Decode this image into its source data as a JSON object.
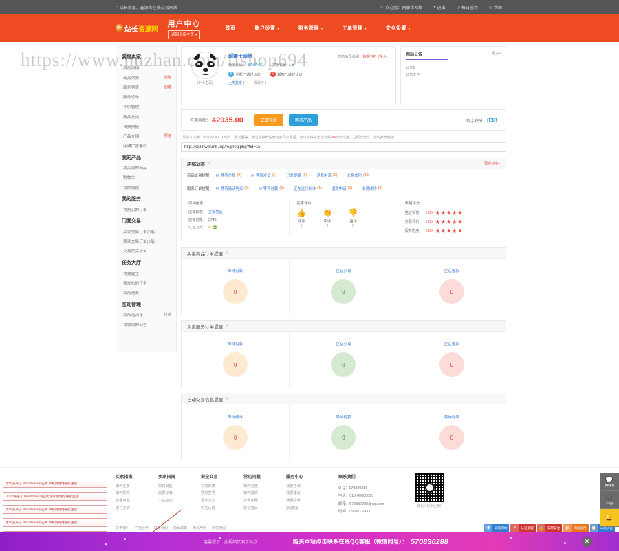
{
  "topbar": {
    "home_icon": "home-icon",
    "slogan": "站长资源，鑫源的在线交易网站",
    "welcome_icon": "user-icon",
    "welcome": "欢迎您：网嫌士网络",
    "logout_caret": "chevron-down-icon",
    "logout": "退出",
    "signin_icon": "clock-icon",
    "signin": "每日签到",
    "help_icon": "question-icon",
    "help": "帮助"
  },
  "nav": {
    "logo_a": "站长",
    "logo_b": "资源网",
    "center_title": "用户中心",
    "back_home": "返回合店主页",
    "items": [
      {
        "label": "首页",
        "caret": false
      },
      {
        "label": "账户设置",
        "caret": true
      },
      {
        "label": "财务管理",
        "caret": true
      },
      {
        "label": "工单管理",
        "caret": true
      },
      {
        "label": "安全设置",
        "caret": true
      }
    ]
  },
  "sidebar": {
    "groups": [
      {
        "title": "我是卖家",
        "items": [
          {
            "label": "我的店铺",
            "tag": ""
          },
          {
            "label": "商品列表",
            "tag": "创建"
          },
          {
            "label": "服务列表",
            "tag": "创建"
          },
          {
            "label": "服务订单",
            "tag": ""
          },
          {
            "label": "评价管理",
            "tag": ""
          },
          {
            "label": "商品分类",
            "tag": ""
          },
          {
            "label": "自费模板",
            "tag": ""
          },
          {
            "label": "产品介绍",
            "tag": "预览"
          },
          {
            "label": "店铺广告素材",
            "tag": ""
          }
        ]
      },
      {
        "title": "我的产品",
        "items": [
          {
            "label": "我买到的商品",
            "tag": ""
          },
          {
            "label": "购物车",
            "tag": ""
          },
          {
            "label": "我的收藏",
            "tag": ""
          }
        ]
      },
      {
        "title": "我的服务",
        "items": [
          {
            "label": "我购买的订单",
            "tag": ""
          }
        ]
      },
      {
        "title": "门面交易",
        "items": [
          {
            "label": "买家交易订单(0笔)",
            "tag": ""
          },
          {
            "label": "卖家交易订单(0笔)",
            "tag": ""
          },
          {
            "label": "交易已完成单",
            "tag": ""
          }
        ]
      },
      {
        "title": "任务大厅",
        "items": [
          {
            "label": "我要雇主",
            "tag": ""
          },
          {
            "label": "我发布的任务",
            "tag": ""
          },
          {
            "label": "我的任务",
            "tag": ""
          }
        ]
      },
      {
        "title": "互动管理",
        "items": [
          {
            "label": "我的站内信",
            "tag": "投稿"
          },
          {
            "label": "我收到的公告",
            "tag": ""
          }
        ]
      }
    ]
  },
  "profile": {
    "avatar_name": "panda-avatar",
    "avatar_label": "(个人主页)",
    "username": "网嫌士网络",
    "vip_label": "您的会员级别：",
    "vip_value": "铂金VIP（永久）",
    "seller_label": "卖家评价：",
    "seller_icons": "💎💎💎",
    "buyer_label": "买家评价：",
    "buyer_icon": "★",
    "verify_phone": "手机已通过认证",
    "verify_mail": "邮箱已通过认证",
    "link_realname": "上传鉴定丨",
    "link_ip": "修改IP丨"
  },
  "notice": {
    "title": "网站公告",
    "more": "更多+",
    "items": [
      "公告2",
      "公告天下"
    ]
  },
  "balance": {
    "label": "可用余额：",
    "value": "42935.00",
    "recharge": "立即充值",
    "buy": "购买产品",
    "points_label": "剩余积分：",
    "points": "830"
  },
  "promo": {
    "text_a": "凡是以下推广到您的QQ、QQ群、朋友圈等，通过您推荐注册的会员交易后，",
    "text_b": "您均可得与此次交易",
    "highlight": "2%",
    "text_c": "的分成金，立即去分享，您的推荐链接：",
    "url": "http://xz23.wbsmb.top/reg/reg.php?tid=15"
  },
  "shop_dynamics": {
    "title": "店铺动态",
    "more": "更多动态+",
    "row1_label": "商品交易提醒：",
    "row1": [
      {
        "label": "等待付款",
        "count": "(0)"
      },
      {
        "label": "等待发货",
        "count": "(1)"
      },
      {
        "label": "订单提醒",
        "count": "(0)"
      },
      {
        "label": "退款申请",
        "count": "(0)"
      },
      {
        "label": "交易成功",
        "count": "(13)"
      }
    ],
    "row2_label": "服务订单提醒：",
    "row2": [
      {
        "label": "等待确认购买",
        "count": "(0)"
      },
      {
        "label": "等待付款",
        "count": "(0)"
      },
      {
        "label": "正在进行制作",
        "count": "(1)"
      },
      {
        "label": "退款申请",
        "count": "(0)"
      },
      {
        "label": "交易成功",
        "count": "(0)"
      }
    ],
    "center": {
      "title": "店铺信息",
      "rows": [
        {
          "k": "店铺状态：",
          "v": "正常营业"
        },
        {
          "k": "店铺流量：",
          "v": "3748"
        },
        {
          "k": "认证方式：",
          "v": "icons"
        }
      ]
    },
    "evaluation": {
      "title": "买家评价",
      "items": [
        {
          "icon": "👍",
          "name": "好评",
          "count": "5"
        },
        {
          "icon": "👏",
          "name": "中评",
          "count": "0"
        },
        {
          "icon": "👎",
          "name": "差评",
          "count": "0"
        }
      ]
    },
    "scores": {
      "title": "店铺评分",
      "rows": [
        {
          "k": "描述相符：",
          "v": "5.00",
          "stars": 5
        },
        {
          "k": "交易评价：",
          "v": "5.00",
          "stars": 5
        },
        {
          "k": "服务态度：",
          "v": "5.00",
          "stars": 5
        }
      ]
    }
  },
  "reminders": [
    {
      "title": "买家商品订单提醒",
      "cells": [
        {
          "label": "等待付款",
          "value": "0",
          "tone": "o"
        },
        {
          "label": "正在交易",
          "value": "0",
          "tone": "g"
        },
        {
          "label": "正在退款",
          "value": "0",
          "tone": "r"
        }
      ]
    },
    {
      "title": "买家服务订单提醒",
      "cells": [
        {
          "label": "等待付款",
          "value": "0",
          "tone": "o"
        },
        {
          "label": "正在交易",
          "value": "0",
          "tone": "g"
        },
        {
          "label": "正在退款",
          "value": "0",
          "tone": "r"
        }
      ]
    },
    {
      "title": "自动交易信息提醒",
      "cells": [
        {
          "label": "等待确认",
          "value": "0",
          "tone": "o"
        },
        {
          "label": "等待付款",
          "value": "0",
          "tone": "g"
        },
        {
          "label": "等待验收",
          "value": "0",
          "tone": "r"
        }
      ]
    }
  ],
  "footer": {
    "columns": [
      {
        "title": "买家指南",
        "links": [
          "如何注册",
          "如何购买",
          "查看商品",
          "支付方式"
        ]
      },
      {
        "title": "卖家指南",
        "links": [
          "如何出售",
          "收费标准",
          "入驻签约"
        ]
      },
      {
        "title": "安全交易",
        "links": [
          "护航保障",
          "预约签号",
          "退款方案",
          "实名认证"
        ]
      },
      {
        "title": "常见问题",
        "links": [
          "如何充值",
          "如何提现",
          "真假客服",
          "忘记密码"
        ]
      },
      {
        "title": "服务中心",
        "links": [
          "我要咨询",
          "我要建议",
          "我要投诉",
          "QQ客服"
        ]
      }
    ],
    "contact": {
      "title": "联系我们",
      "rows": [
        "Q Q：570830288",
        "电话：010-00000000",
        "邮箱：570830288@qq.com",
        "时间：09:00 - 24:00"
      ]
    },
    "qr_caption": "微信扫码中注我们",
    "bottom_links": [
      "关于我们",
      "广告合作",
      "联系我们",
      "隐私政策",
      "免责声明",
      "网站地图"
    ],
    "badges": [
      {
        "icon": "🛡",
        "text": "诚信网站",
        "color": "#2e7fd0"
      },
      {
        "icon": "✔",
        "text": "认证联盟",
        "color": "#d0342e"
      },
      {
        "icon": "🔒",
        "text": "安网安全",
        "color": "#d0342e"
      },
      {
        "icon": "网",
        "text": "网站信用",
        "color": "#e8731c"
      },
      {
        "icon": "📋",
        "text": "工商认证",
        "color": "#2e7fd0"
      }
    ]
  },
  "ads": [
    "卖***买来了 WordPress响应式 手机网站站导航主题",
    "UU***买来了 WordPress响应式 手机网站站导航主题",
    "卖***买来了 WordPress响应式 手机网站站导航主题",
    "唐***买来了 WordPress响应式 手机网站站导航主题",
    "行***x 买来了 WordPress响应式 手机网站站导航主题"
  ],
  "dock": [
    {
      "icon": "💬",
      "label": "联系客服",
      "tone": "gray"
    },
    {
      "icon": "🎧",
      "label": "手机版",
      "tone": "gray"
    },
    {
      "icon": "🔔",
      "label": "",
      "tone": "yellow"
    }
  ],
  "bottombar": {
    "tip": "温馨提示：此视频仅演示站点",
    "main": "购买本站点击联系在线QQ客服（微信同号）：",
    "qq": "570830288",
    "close": "✕"
  },
  "watermark": {
    "line": "https://www.huzhan.com/fishop694"
  }
}
